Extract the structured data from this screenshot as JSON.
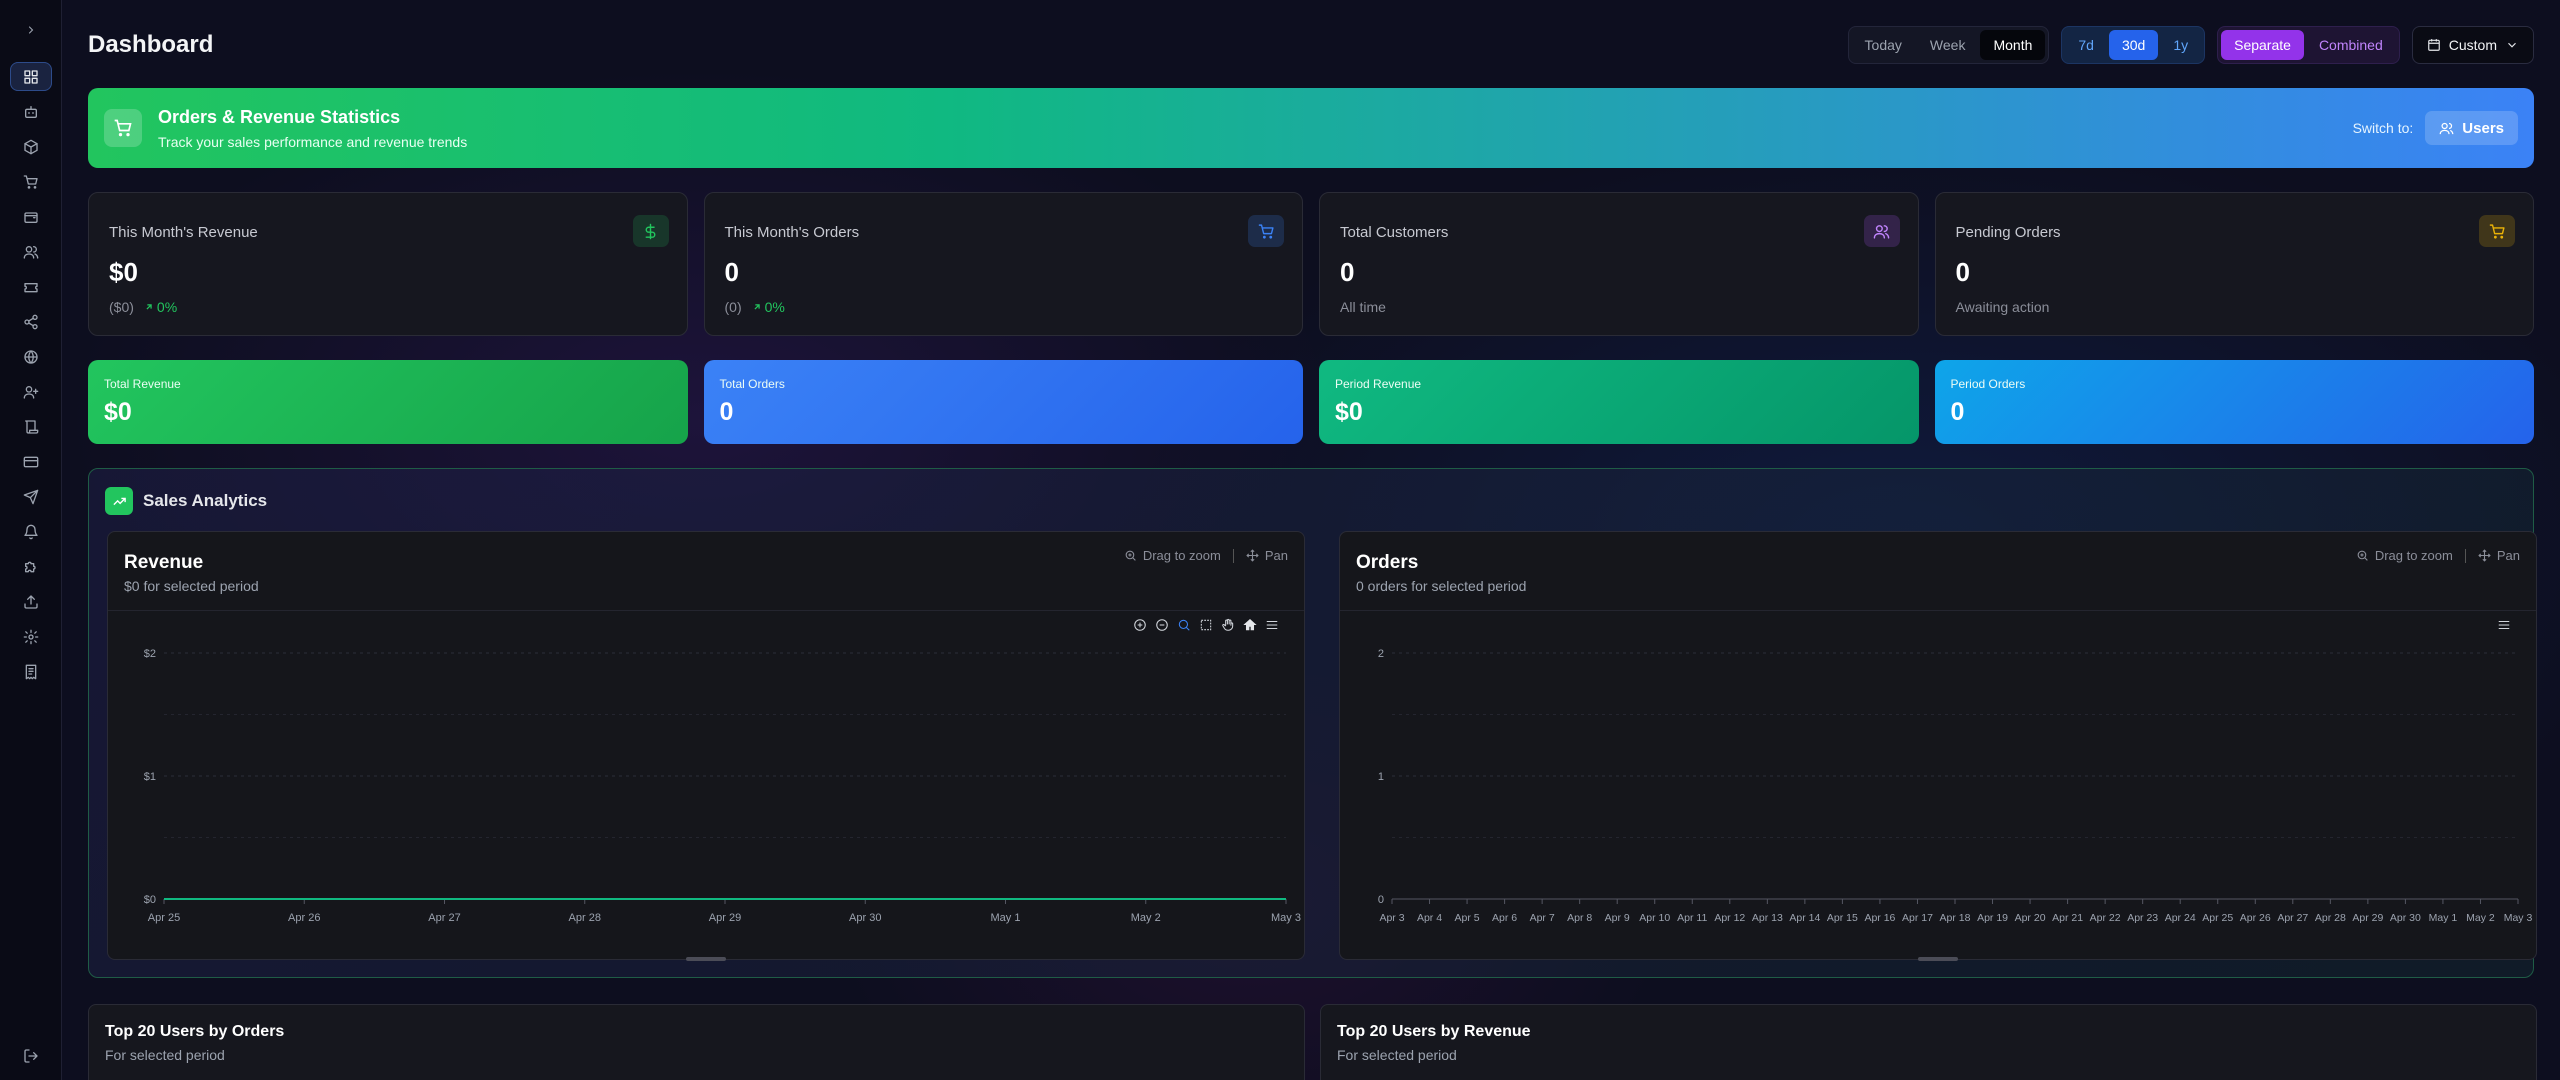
{
  "page": {
    "title": "Dashboard"
  },
  "controls": {
    "range": [
      "Today",
      "Week",
      "Month"
    ],
    "range_selected": "Month",
    "period": [
      "7d",
      "30d",
      "1y"
    ],
    "period_selected": "30d",
    "mode": [
      "Separate",
      "Combined"
    ],
    "mode_selected": "Separate",
    "custom_label": "Custom"
  },
  "banner": {
    "title": "Orders & Revenue Statistics",
    "subtitle": "Track your sales performance and revenue trends",
    "switch_label": "Switch to:",
    "switch_button": "Users"
  },
  "stats": [
    {
      "label": "This Month's Revenue",
      "value": "$0",
      "sub": "($0)",
      "pct": "0%",
      "icon": "dollar-icon",
      "color": "#22c55e"
    },
    {
      "label": "This Month's Orders",
      "value": "0",
      "sub": "(0)",
      "pct": "0%",
      "icon": "cart-icon",
      "color": "#3b82f6"
    },
    {
      "label": "Total Customers",
      "value": "0",
      "sub": "All time",
      "icon": "users-icon",
      "color": "#a855f7"
    },
    {
      "label": "Pending Orders",
      "value": "0",
      "sub": "Awaiting action",
      "icon": "cart-icon",
      "color": "#eab308"
    }
  ],
  "totals": [
    {
      "label": "Total Revenue",
      "value": "$0",
      "color_from": "#22c55e",
      "color_to": "#16a34a"
    },
    {
      "label": "Total Orders",
      "value": "0",
      "color_from": "#3b82f6",
      "color_to": "#2563eb"
    },
    {
      "label": "Period Revenue",
      "value": "$0",
      "color_from": "#10b981",
      "color_to": "#059669"
    },
    {
      "label": "Period Orders",
      "value": "0",
      "color_from": "#0ea5e9",
      "color_to": "#2563eb"
    }
  ],
  "analytics": {
    "title": "Sales Analytics",
    "tools": {
      "zoom": "Drag to zoom",
      "pan": "Pan"
    },
    "revenue": {
      "title": "Revenue",
      "subtitle": "$0 for selected period"
    },
    "orders": {
      "title": "Orders",
      "subtitle": "0 orders for selected period"
    }
  },
  "chart_data": [
    {
      "type": "line",
      "title": "Revenue",
      "x": [
        "Apr 25",
        "Apr 26",
        "Apr 27",
        "Apr 28",
        "Apr 29",
        "Apr 30",
        "May 1",
        "May 2",
        "May 3"
      ],
      "series": [
        {
          "values": [
            0,
            0,
            0,
            0,
            0,
            0,
            0,
            0,
            0
          ],
          "color": "#10b981"
        }
      ],
      "yticks": [
        "$0",
        "$1",
        "$2"
      ],
      "ylim": [
        0,
        2
      ],
      "grid": true
    },
    {
      "type": "bar",
      "title": "Orders",
      "x": [
        "Apr 3",
        "Apr 4",
        "Apr 5",
        "Apr 6",
        "Apr 7",
        "Apr 8",
        "Apr 9",
        "Apr 10",
        "Apr 11",
        "Apr 12",
        "Apr 13",
        "Apr 14",
        "Apr 15",
        "Apr 16",
        "Apr 17",
        "Apr 18",
        "Apr 19",
        "Apr 20",
        "Apr 21",
        "Apr 22",
        "Apr 23",
        "Apr 24",
        "Apr 25",
        "Apr 26",
        "Apr 27",
        "Apr 28",
        "Apr 29",
        "Apr 30",
        "May 1",
        "May 2",
        "May 3"
      ],
      "series": [
        {
          "values": [
            0,
            0,
            0,
            0,
            0,
            0,
            0,
            0,
            0,
            0,
            0,
            0,
            0,
            0,
            0,
            0,
            0,
            0,
            0,
            0,
            0,
            0,
            0,
            0,
            0,
            0,
            0,
            0,
            0,
            0,
            0
          ]
        }
      ],
      "yticks": [
        "0",
        "1",
        "2"
      ],
      "ylim": [
        0,
        2
      ],
      "grid": true
    }
  ],
  "bottom": {
    "left": {
      "title": "Top 20 Users by Orders",
      "subtitle": "For selected period"
    },
    "right": {
      "title": "Top 20 Users by Revenue",
      "subtitle": "For selected period"
    }
  }
}
